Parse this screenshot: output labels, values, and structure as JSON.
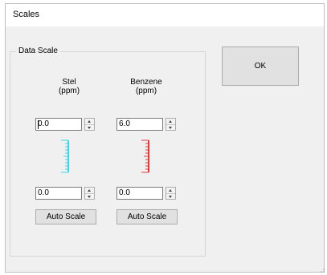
{
  "window": {
    "title": "Scales"
  },
  "group": {
    "legend": "Data Scale"
  },
  "ok_button": {
    "label": "OK"
  },
  "columns": [
    {
      "name_line1": "Stel",
      "name_line2": "(ppm)",
      "max_value": "0.0",
      "min_value": "0.0",
      "auto_scale_label": "Auto Scale",
      "scale_color": "#38d8e8"
    },
    {
      "name_line1": "Benzene",
      "name_line2": "(ppm)",
      "max_value": "6.0",
      "min_value": "0.0",
      "auto_scale_label": "Auto Scale",
      "scale_color": "#e43a3a"
    }
  ]
}
